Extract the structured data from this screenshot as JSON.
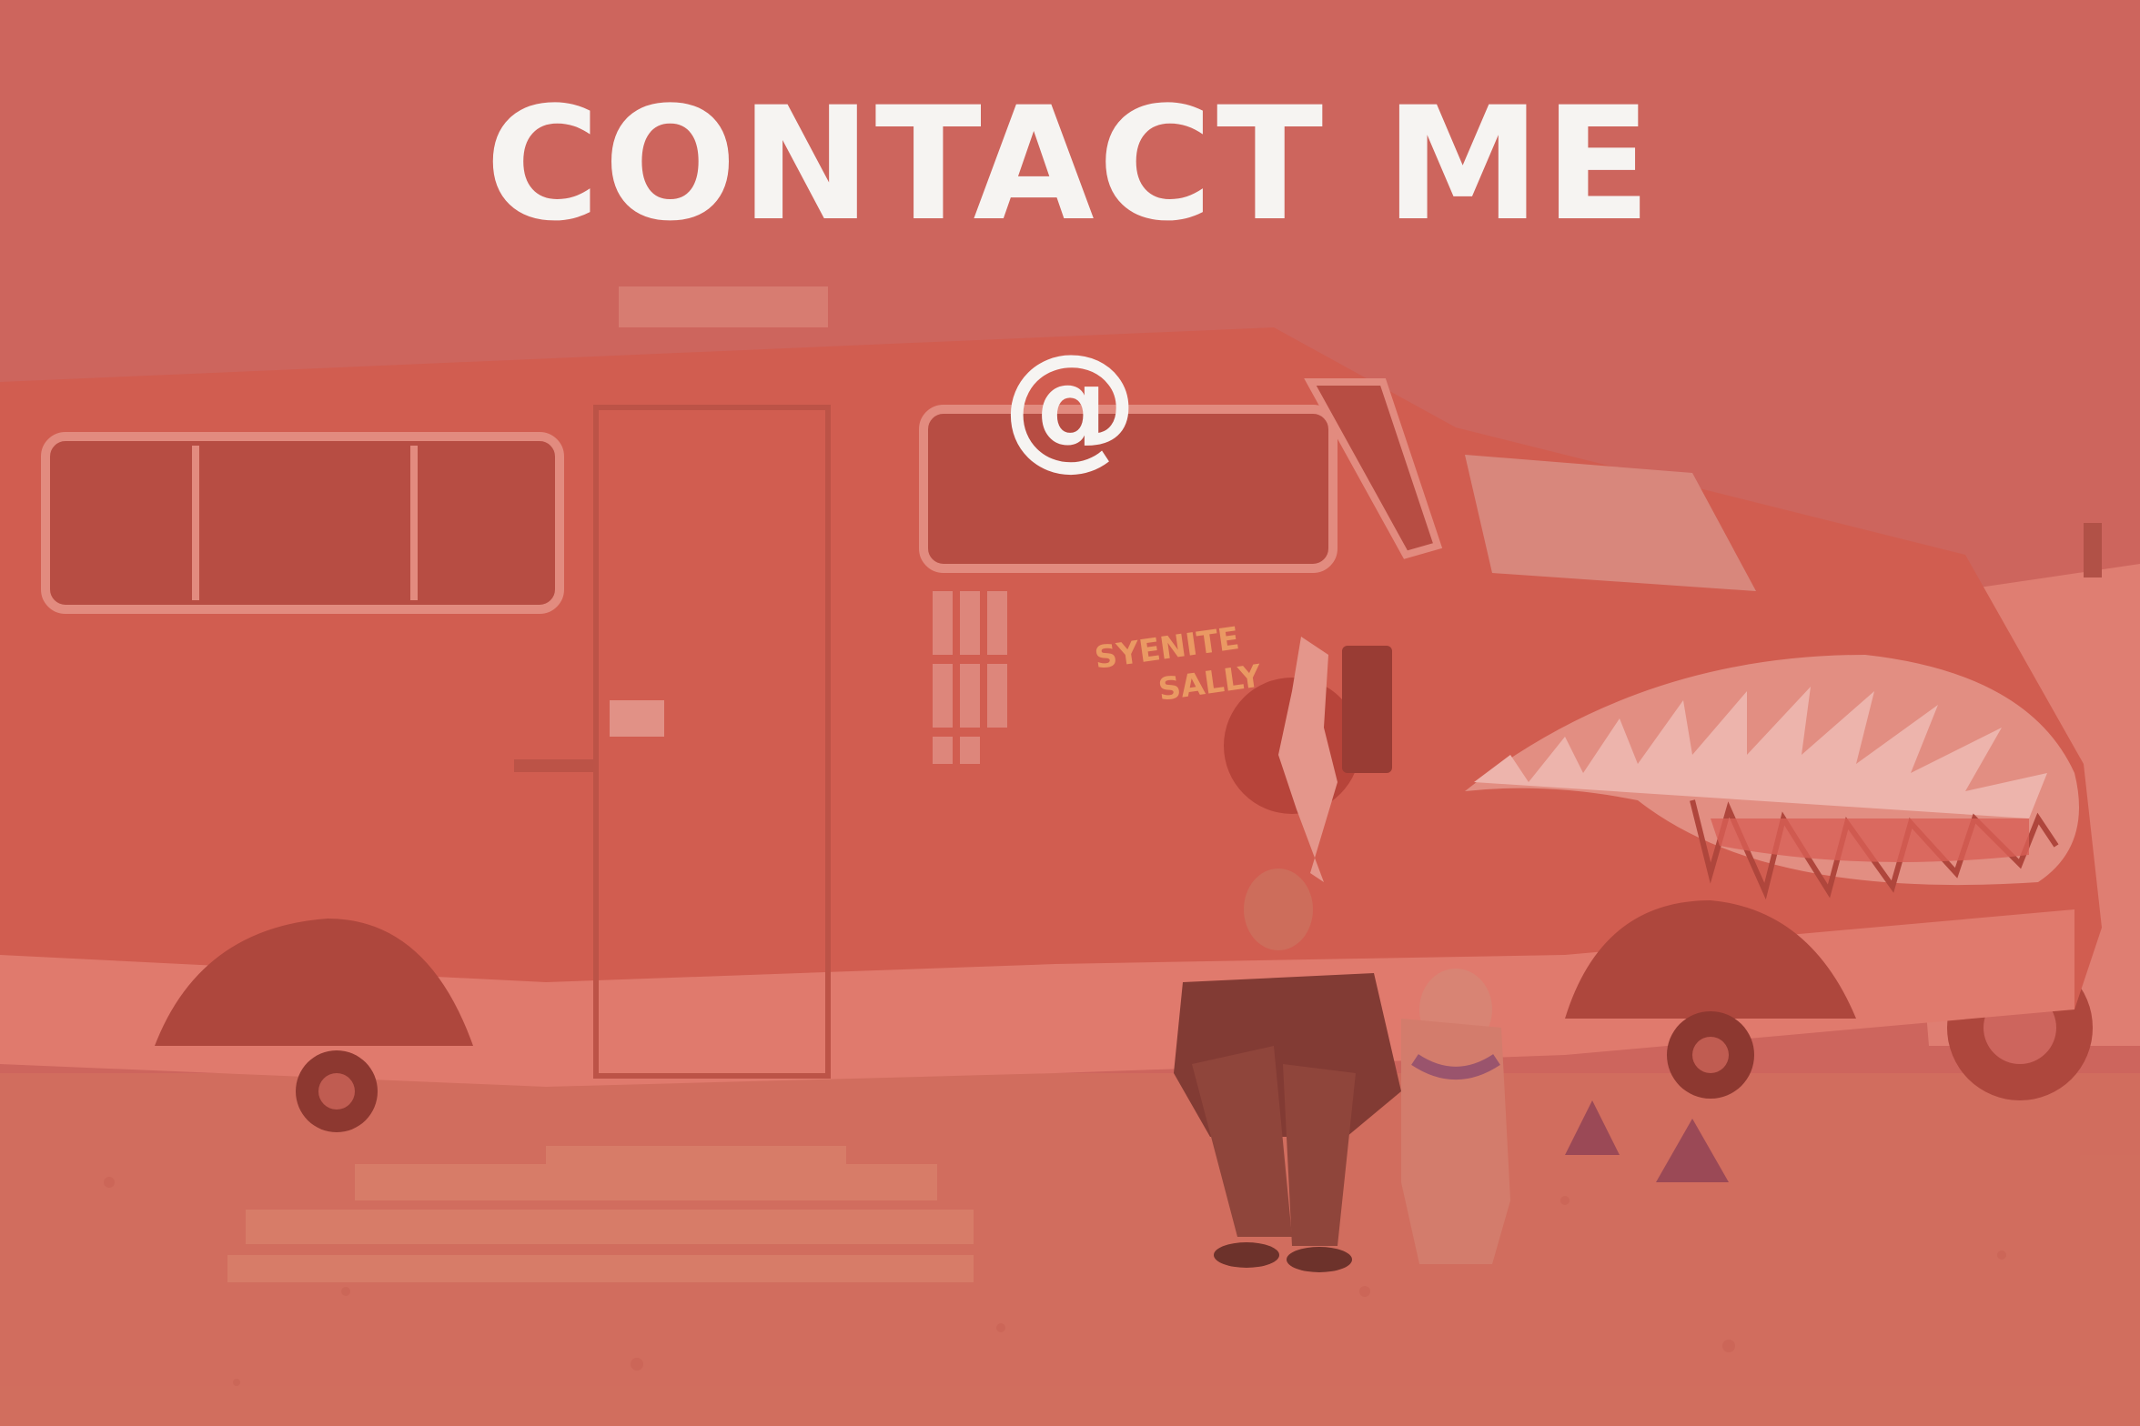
{
  "headline": "CONTACT ME",
  "at_symbol": "@",
  "van_lettering": "SYENITE SALLY",
  "colors": {
    "sky": "#c96762",
    "van_body": "#cf5c4f",
    "ground": "#cf7463",
    "text": "#f6f4f2"
  }
}
